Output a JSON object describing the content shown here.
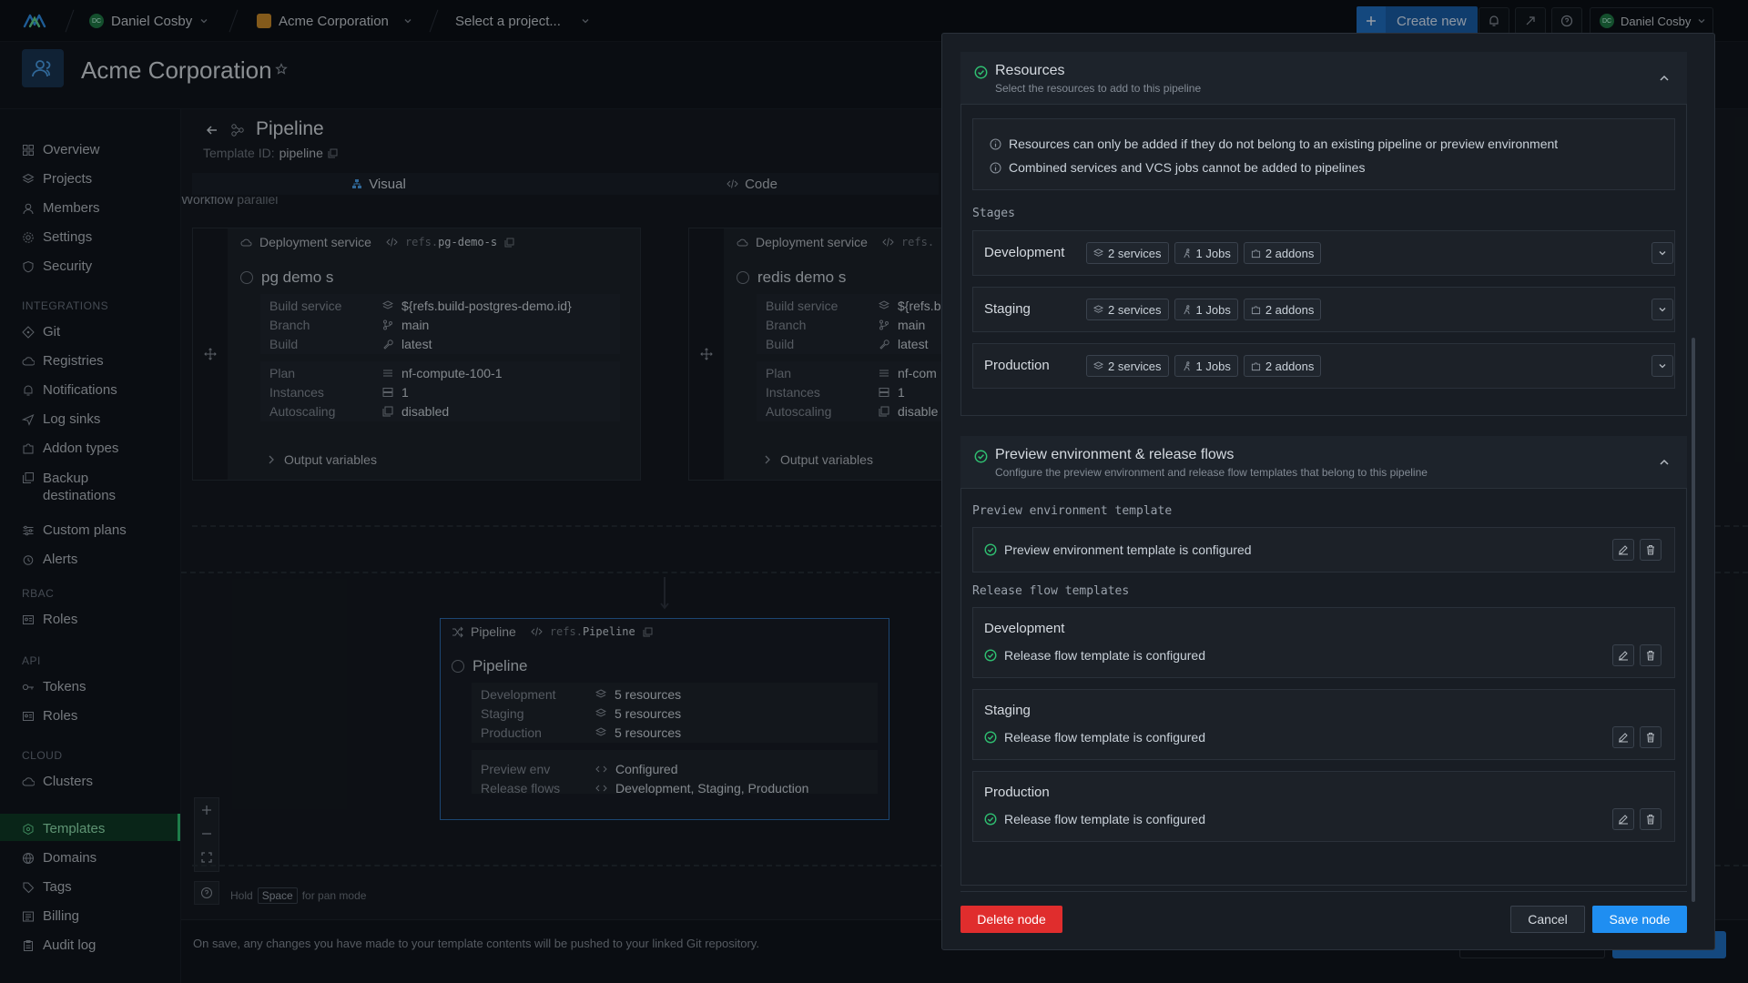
{
  "topbar": {
    "user_label": "Daniel Cosby",
    "user_initials": "DC",
    "org_label": "Acme Corporation",
    "project_select": "Select a project...",
    "create_new_label": "Create new",
    "right_user_label": "Daniel Cosby"
  },
  "header": {
    "org_title": "Acme Corporation"
  },
  "sidebar": {
    "items": [
      {
        "label": "Overview"
      },
      {
        "label": "Projects"
      },
      {
        "label": "Members"
      },
      {
        "label": "Settings"
      },
      {
        "label": "Security"
      }
    ],
    "integrations_title": "INTEGRATIONS",
    "integrations": [
      {
        "label": "Git"
      },
      {
        "label": "Registries"
      },
      {
        "label": "Notifications"
      },
      {
        "label": "Log sinks"
      },
      {
        "label": "Addon types"
      },
      {
        "label": "Backup destinations",
        "line1": "Backup",
        "line2": "destinations"
      },
      {
        "label": "Custom plans"
      },
      {
        "label": "Alerts"
      }
    ],
    "rbac_title": "RBAC",
    "rbac": [
      {
        "label": "Roles"
      }
    ],
    "api_title": "API",
    "api": [
      {
        "label": "Tokens"
      },
      {
        "label": "Roles"
      }
    ],
    "cloud_title": "CLOUD",
    "cloud": [
      {
        "label": "Clusters"
      }
    ],
    "bottom": [
      {
        "label": "Templates",
        "active": true
      },
      {
        "label": "Domains"
      },
      {
        "label": "Tags"
      },
      {
        "label": "Billing"
      },
      {
        "label": "Audit log"
      }
    ]
  },
  "pipeline_page": {
    "title": "Pipeline",
    "template_id_label": "Template ID:",
    "template_id_value": "pipeline",
    "tab_visual": "Visual",
    "tab_code": "Code",
    "workflow_label": "Workflow",
    "workflow_value": "parallel",
    "footer_note": "On save, any changes you have made to your template contents will be pushed to your linked Git repository.",
    "hint_hold": "Hold",
    "hint_key": "Space",
    "hint_rest": "for pan mode"
  },
  "nodes": [
    {
      "type": "Deployment service",
      "ref_prefix": "refs.",
      "ref": "pg-demo-s",
      "name": "pg demo s",
      "build_service_label": "Build service",
      "build_service": "${refs.build-postgres-demo.id}",
      "branch_label": "Branch",
      "branch": "main",
      "build_label": "Build",
      "build": "latest",
      "plan_label": "Plan",
      "plan": "nf-compute-100-1",
      "instances_label": "Instances",
      "instances": "1",
      "autoscaling_label": "Autoscaling",
      "autoscaling": "disabled",
      "output_label": "Output variables"
    },
    {
      "type": "Deployment service",
      "ref_prefix": "refs.",
      "ref": "",
      "name": "redis demo s",
      "build_service_label": "Build service",
      "build_service": "${refs.b",
      "branch_label": "Branch",
      "branch": "main",
      "build_label": "Build",
      "build": "latest",
      "plan_label": "Plan",
      "plan": "nf-com",
      "instances_label": "Instances",
      "instances": "1",
      "autoscaling_label": "Autoscaling",
      "autoscaling": "disable",
      "output_label": "Output variables"
    }
  ],
  "pipeline_node": {
    "type": "Pipeline",
    "ref_prefix": "refs.",
    "ref": "Pipeline",
    "name": "Pipeline",
    "rows": [
      {
        "label": "Development",
        "value": "5 resources"
      },
      {
        "label": "Staging",
        "value": "5 resources"
      },
      {
        "label": "Production",
        "value": "5 resources"
      }
    ],
    "preview_label": "Preview env",
    "preview_value": "Configured",
    "release_label": "Release flows",
    "release_value": "Development, Staging, Production"
  },
  "panel": {
    "resources": {
      "title": "Resources",
      "subtitle": "Select the resources to add to this pipeline",
      "info1": "Resources can only be added if they do not belong to an existing pipeline or preview environment",
      "info2": "Combined services and VCS jobs cannot be added to pipelines",
      "stages_label": "Stages",
      "stages": [
        {
          "name": "Development",
          "services": "2 services",
          "jobs": "1 Jobs",
          "addons": "2 addons"
        },
        {
          "name": "Staging",
          "services": "2 services",
          "jobs": "1 Jobs",
          "addons": "2 addons"
        },
        {
          "name": "Production",
          "services": "2 services",
          "jobs": "1 Jobs",
          "addons": "2 addons"
        }
      ]
    },
    "preview": {
      "title": "Preview environment & release flows",
      "subtitle": "Configure the preview environment and release flow templates that belong to this pipeline",
      "template_label": "Preview environment template",
      "template_status": "Preview environment template is configured",
      "release_label": "Release flow templates",
      "flows": [
        {
          "name": "Development",
          "status": "Release flow template is configured"
        },
        {
          "name": "Staging",
          "status": "Release flow template is configured"
        },
        {
          "name": "Production",
          "status": "Release flow template is configured"
        }
      ]
    },
    "delete_label": "Delete node",
    "cancel_label": "Cancel",
    "save_label": "Save node"
  },
  "colors": {
    "accent_blue": "#1f8ef1",
    "danger_red": "#e02d2d",
    "success_green": "#2fbf71",
    "sidebar_active": "#0f3a25"
  }
}
